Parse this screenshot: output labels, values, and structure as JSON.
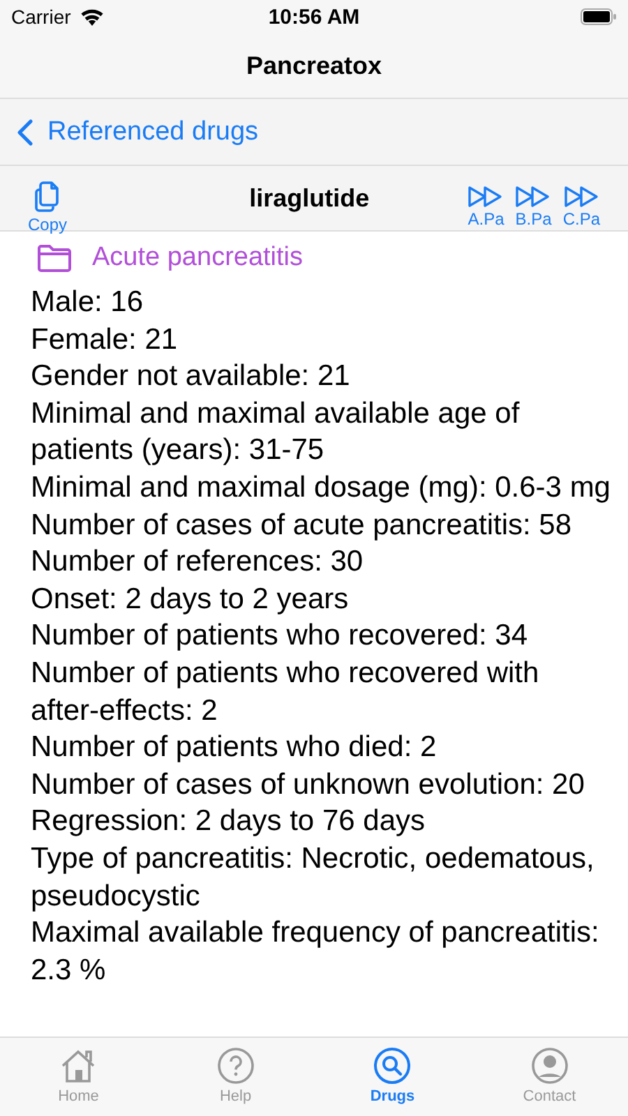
{
  "status_bar": {
    "carrier": "Carrier",
    "time": "10:56 AM"
  },
  "nav": {
    "title": "Pancreatox",
    "back": "Referenced drugs"
  },
  "toolbar": {
    "copy": "Copy",
    "drug": "liraglutide",
    "jumps": [
      "A.Pa",
      "B.Pa",
      "C.Pa"
    ]
  },
  "section": {
    "title": "Acute pancreatitis"
  },
  "details": [
    "Male: 16",
    "Female: 21",
    "Gender not available: 21",
    "Minimal and maximal available age of patients (years): 31-75",
    "Minimal and maximal dosage (mg): 0.6-3 mg",
    "Number of cases of acute pancreatitis: 58",
    "Number of references: 30",
    "Onset: 2 days to 2 years",
    "Number of patients who recovered: 34",
    "Number of patients who recovered with after-effects: 2",
    "Number of patients who died: 2",
    "Number of cases of unknown evolution: 20",
    "Regression: 2 days to 76 days",
    "Type of pancreatitis: Necrotic, oedematous, pseudocystic",
    "Maximal available frequency of pancreatitis: 2.3 %"
  ],
  "tabs": [
    {
      "label": "Home",
      "selected": false
    },
    {
      "label": "Help",
      "selected": false
    },
    {
      "label": "Drugs",
      "selected": true
    },
    {
      "label": "Contact",
      "selected": false
    }
  ]
}
